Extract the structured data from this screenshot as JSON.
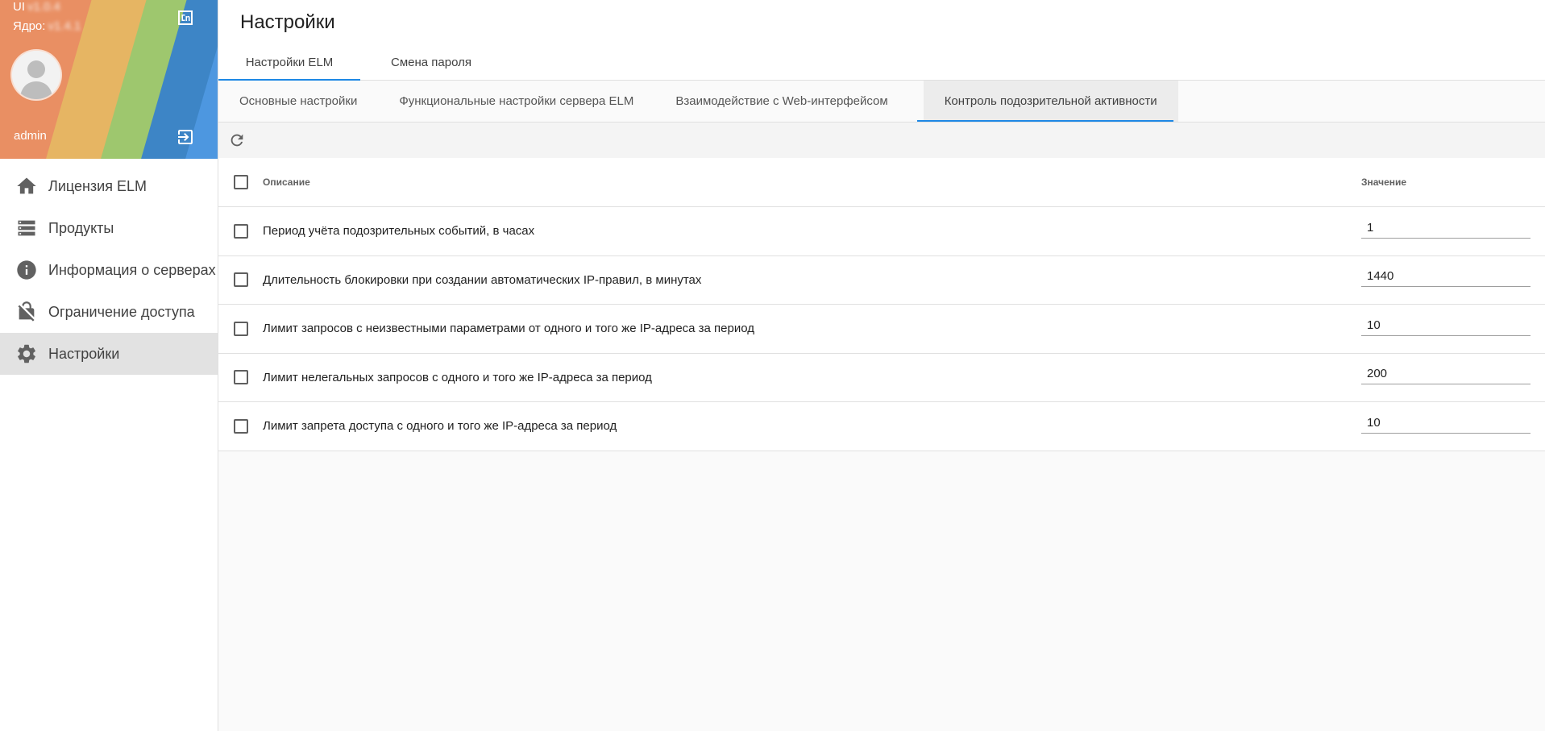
{
  "sidebar": {
    "version_ui_label": "UI",
    "version_ui_value": "v1.0.4",
    "version_core_label": "Ядро:",
    "version_core_value": "v1.4.1",
    "username": "admin",
    "items": [
      {
        "label": "Лицензия ELM",
        "icon": "home-icon"
      },
      {
        "label": "Продукты",
        "icon": "list-icon"
      },
      {
        "label": "Информация о серверах",
        "icon": "info-icon"
      },
      {
        "label": "Ограничение доступа",
        "icon": "lock-off-icon"
      },
      {
        "label": "Настройки",
        "icon": "gear-icon",
        "active": true
      }
    ]
  },
  "header": {
    "title": "Настройки",
    "tabs": [
      {
        "label": "Настройки ELM",
        "active": true
      },
      {
        "label": "Смена пароля",
        "active": false
      }
    ]
  },
  "subtabs": [
    {
      "label": "Основные настройки",
      "active": false
    },
    {
      "label": "Функциональные настройки сервера ELM",
      "active": false
    },
    {
      "label": "Взаимодействие с Web-интерфейсом",
      "active": false
    },
    {
      "label": "Контроль подозрительной активности",
      "active": true
    }
  ],
  "table": {
    "columns": {
      "description": "Описание",
      "value": "Значение"
    },
    "rows": [
      {
        "description": "Период учёта подозрительных событий, в часах",
        "value": "1"
      },
      {
        "description": "Длительность блокировки при создании автоматических IP-правил, в минутах",
        "value": "1440"
      },
      {
        "description": "Лимит запросов с неизвестными параметрами от одного и того же IP-адреса за период",
        "value": "10"
      },
      {
        "description": "Лимит нелегальных запросов с одного и того же IP-адреса за период",
        "value": "200"
      },
      {
        "description": "Лимит запрета доступа с одного и того же IP-адреса за период",
        "value": "10"
      }
    ]
  },
  "colors": {
    "accent": "#1e88e5",
    "active_nav_bg": "#e2e2e2"
  }
}
